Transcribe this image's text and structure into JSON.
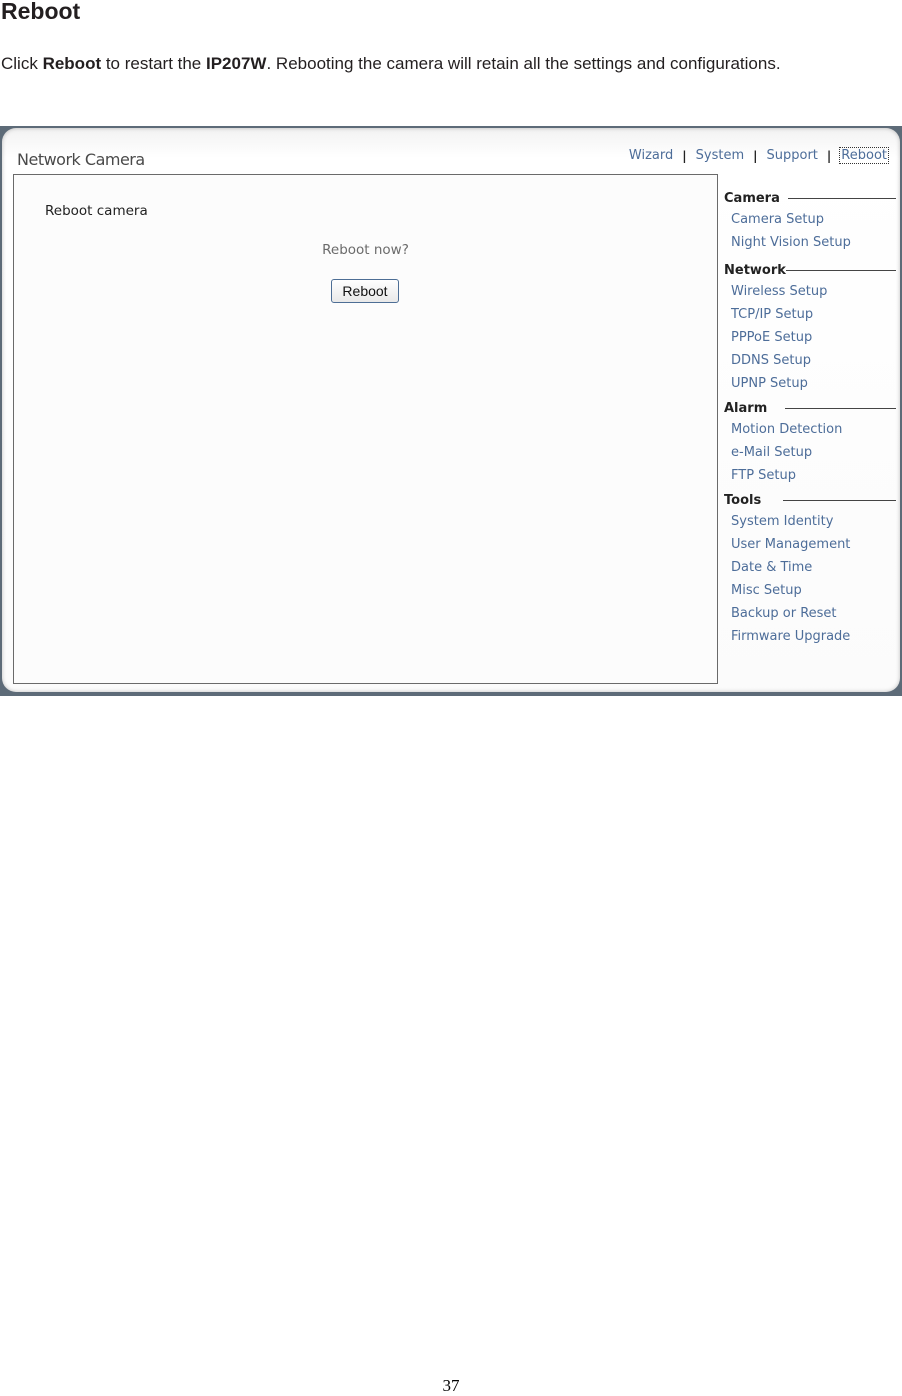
{
  "document": {
    "title": "Reboot",
    "paragraph": {
      "part1": "Click ",
      "bold1": "Reboot",
      "part2": " to restart the ",
      "bold2": "IP207W",
      "part3": ". Rebooting the camera will retain all the settings and configurations."
    },
    "page_number": "37"
  },
  "screenshot": {
    "app_title": "Network Camera",
    "top_nav": [
      {
        "label": "Wizard",
        "active": false
      },
      {
        "label": "System",
        "active": false
      },
      {
        "label": "Support",
        "active": false
      },
      {
        "label": "Reboot",
        "active": true
      }
    ],
    "panel": {
      "heading": "Reboot camera",
      "confirm_text": "Reboot now?",
      "button_label": "Reboot"
    },
    "sidebar": {
      "sections": [
        {
          "title": "Camera",
          "items": [
            "Camera Setup",
            "Night Vision Setup"
          ]
        },
        {
          "title": "Network",
          "items": [
            "Wireless Setup",
            "TCP/IP Setup",
            "PPPoE Setup",
            "DDNS Setup",
            "UPNP Setup"
          ]
        },
        {
          "title": "Alarm",
          "items": [
            "Motion Detection",
            "e-Mail Setup",
            "FTP Setup"
          ]
        },
        {
          "title": "Tools",
          "items": [
            "System Identity",
            "User Management",
            "Date & Time",
            "Misc Setup",
            "Backup or Reset",
            "Firmware Upgrade"
          ]
        }
      ]
    },
    "colors": {
      "link": "#4d6d99",
      "frame_border": "#5d6b78"
    }
  }
}
